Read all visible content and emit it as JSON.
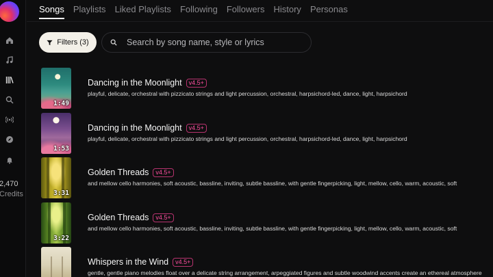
{
  "sidebar": {
    "icons": [
      "home-icon",
      "music-note-icon",
      "library-icon",
      "search-icon",
      "radio-icon",
      "compass-icon",
      "bell-icon"
    ],
    "credits_value": "2,470",
    "credits_label": "Credits"
  },
  "tabs": [
    {
      "label": "Songs",
      "active": true
    },
    {
      "label": "Playlists",
      "active": false
    },
    {
      "label": "Liked Playlists",
      "active": false
    },
    {
      "label": "Following",
      "active": false
    },
    {
      "label": "Followers",
      "active": false
    },
    {
      "label": "History",
      "active": false
    },
    {
      "label": "Personas",
      "active": false
    }
  ],
  "filters": {
    "label": "Filters (3)"
  },
  "search": {
    "placeholder": "Search by song name, style or lyrics"
  },
  "songs": [
    {
      "title": "Dancing in the Moonlight",
      "version": "v4.5+",
      "duration": "1:49",
      "description": "playful, delicate, orchestral with pizzicato strings and light percussion, orchestral, harpsichord-led, dance, light, harpsichord"
    },
    {
      "title": "Dancing in the Moonlight",
      "version": "v4.5+",
      "duration": "1:53",
      "description": "playful, delicate, orchestral with pizzicato strings and light percussion, orchestral, harpsichord-led, dance, light, harpsichord"
    },
    {
      "title": "Golden Threads",
      "version": "v4.5+",
      "duration": "3:31",
      "description": "and mellow cello harmonies, soft acoustic, bassline, inviting, subtle bassline, with gentle fingerpicking, light, mellow, cello, warm, acoustic, soft"
    },
    {
      "title": "Golden Threads",
      "version": "v4.5+",
      "duration": "3:22",
      "description": "and mellow cello harmonies, soft acoustic, bassline, inviting, subtle bassline, with gentle fingerpicking, light, mellow, cello, warm, acoustic, soft"
    },
    {
      "title": "Whispers in the Wind",
      "version": "v4.5+",
      "duration": "",
      "description": "gentle, gentle piano melodies float over a delicate string arrangement, arpeggiated figures and subtle woodwind accents create an ethereal atmosphere"
    }
  ]
}
